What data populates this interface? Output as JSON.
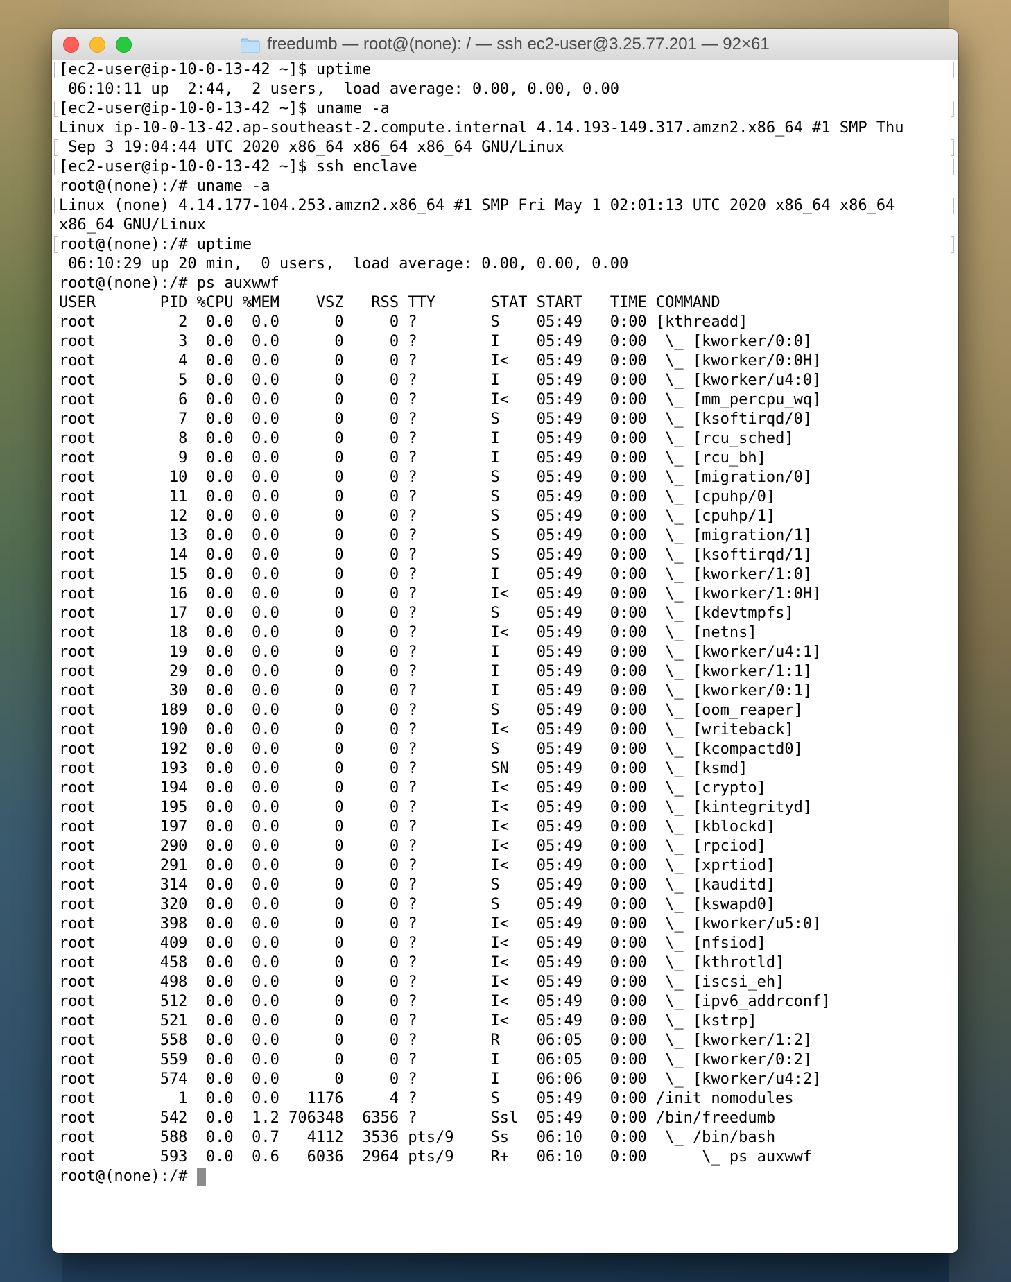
{
  "window": {
    "title": "freedumb — root@(none): / — ssh ec2-user@3.25.77.201 — 92×61"
  },
  "terminal": {
    "lines": [
      {
        "text": "[ec2-user@ip-10-0-13-42 ~]$ uptime",
        "mark": true
      },
      {
        "text": " 06:10:11 up  2:44,  2 users,  load average: 0.00, 0.00, 0.00",
        "mark": false
      },
      {
        "text": "[ec2-user@ip-10-0-13-42 ~]$ uname -a",
        "mark": true
      },
      {
        "text": "Linux ip-10-0-13-42.ap-southeast-2.compute.internal 4.14.193-149.317.amzn2.x86_64 #1 SMP Thu",
        "mark": false
      },
      {
        "text": " Sep 3 19:04:44 UTC 2020 x86_64 x86_64 x86_64 GNU/Linux",
        "mark": true
      },
      {
        "text": "[ec2-user@ip-10-0-13-42 ~]$ ssh enclave",
        "mark": true
      },
      {
        "text": "root@(none):/# uname -a",
        "mark": false
      },
      {
        "text": "Linux (none) 4.14.177-104.253.amzn2.x86_64 #1 SMP Fri May 1 02:01:13 UTC 2020 x86_64 x86_64",
        "mark": true
      },
      {
        "text": "x86_64 GNU/Linux",
        "mark": false
      },
      {
        "text": "root@(none):/# uptime",
        "mark": true
      },
      {
        "text": " 06:10:29 up 20 min,  0 users,  load average: 0.00, 0.00, 0.00",
        "mark": false
      },
      {
        "text": "root@(none):/# ps auxwwf",
        "mark": false
      },
      {
        "text": "USER       PID %CPU %MEM    VSZ   RSS TTY      STAT START   TIME COMMAND",
        "mark": false
      },
      {
        "text": "root         2  0.0  0.0      0     0 ?        S    05:49   0:00 [kthreadd]",
        "mark": false
      },
      {
        "text": "root         3  0.0  0.0      0     0 ?        I    05:49   0:00  \\_ [kworker/0:0]",
        "mark": false
      },
      {
        "text": "root         4  0.0  0.0      0     0 ?        I<   05:49   0:00  \\_ [kworker/0:0H]",
        "mark": false
      },
      {
        "text": "root         5  0.0  0.0      0     0 ?        I    05:49   0:00  \\_ [kworker/u4:0]",
        "mark": false
      },
      {
        "text": "root         6  0.0  0.0      0     0 ?        I<   05:49   0:00  \\_ [mm_percpu_wq]",
        "mark": false
      },
      {
        "text": "root         7  0.0  0.0      0     0 ?        S    05:49   0:00  \\_ [ksoftirqd/0]",
        "mark": false
      },
      {
        "text": "root         8  0.0  0.0      0     0 ?        I    05:49   0:00  \\_ [rcu_sched]",
        "mark": false
      },
      {
        "text": "root         9  0.0  0.0      0     0 ?        I    05:49   0:00  \\_ [rcu_bh]",
        "mark": false
      },
      {
        "text": "root        10  0.0  0.0      0     0 ?        S    05:49   0:00  \\_ [migration/0]",
        "mark": false
      },
      {
        "text": "root        11  0.0  0.0      0     0 ?        S    05:49   0:00  \\_ [cpuhp/0]",
        "mark": false
      },
      {
        "text": "root        12  0.0  0.0      0     0 ?        S    05:49   0:00  \\_ [cpuhp/1]",
        "mark": false
      },
      {
        "text": "root        13  0.0  0.0      0     0 ?        S    05:49   0:00  \\_ [migration/1]",
        "mark": false
      },
      {
        "text": "root        14  0.0  0.0      0     0 ?        S    05:49   0:00  \\_ [ksoftirqd/1]",
        "mark": false
      },
      {
        "text": "root        15  0.0  0.0      0     0 ?        I    05:49   0:00  \\_ [kworker/1:0]",
        "mark": false
      },
      {
        "text": "root        16  0.0  0.0      0     0 ?        I<   05:49   0:00  \\_ [kworker/1:0H]",
        "mark": false
      },
      {
        "text": "root        17  0.0  0.0      0     0 ?        S    05:49   0:00  \\_ [kdevtmpfs]",
        "mark": false
      },
      {
        "text": "root        18  0.0  0.0      0     0 ?        I<   05:49   0:00  \\_ [netns]",
        "mark": false
      },
      {
        "text": "root        19  0.0  0.0      0     0 ?        I    05:49   0:00  \\_ [kworker/u4:1]",
        "mark": false
      },
      {
        "text": "root        29  0.0  0.0      0     0 ?        I    05:49   0:00  \\_ [kworker/1:1]",
        "mark": false
      },
      {
        "text": "root        30  0.0  0.0      0     0 ?        I    05:49   0:00  \\_ [kworker/0:1]",
        "mark": false
      },
      {
        "text": "root       189  0.0  0.0      0     0 ?        S    05:49   0:00  \\_ [oom_reaper]",
        "mark": false
      },
      {
        "text": "root       190  0.0  0.0      0     0 ?        I<   05:49   0:00  \\_ [writeback]",
        "mark": false
      },
      {
        "text": "root       192  0.0  0.0      0     0 ?        S    05:49   0:00  \\_ [kcompactd0]",
        "mark": false
      },
      {
        "text": "root       193  0.0  0.0      0     0 ?        SN   05:49   0:00  \\_ [ksmd]",
        "mark": false
      },
      {
        "text": "root       194  0.0  0.0      0     0 ?        I<   05:49   0:00  \\_ [crypto]",
        "mark": false
      },
      {
        "text": "root       195  0.0  0.0      0     0 ?        I<   05:49   0:00  \\_ [kintegrityd]",
        "mark": false
      },
      {
        "text": "root       197  0.0  0.0      0     0 ?        I<   05:49   0:00  \\_ [kblockd]",
        "mark": false
      },
      {
        "text": "root       290  0.0  0.0      0     0 ?        I<   05:49   0:00  \\_ [rpciod]",
        "mark": false
      },
      {
        "text": "root       291  0.0  0.0      0     0 ?        I<   05:49   0:00  \\_ [xprtiod]",
        "mark": false
      },
      {
        "text": "root       314  0.0  0.0      0     0 ?        S    05:49   0:00  \\_ [kauditd]",
        "mark": false
      },
      {
        "text": "root       320  0.0  0.0      0     0 ?        S    05:49   0:00  \\_ [kswapd0]",
        "mark": false
      },
      {
        "text": "root       398  0.0  0.0      0     0 ?        I<   05:49   0:00  \\_ [kworker/u5:0]",
        "mark": false
      },
      {
        "text": "root       409  0.0  0.0      0     0 ?        I<   05:49   0:00  \\_ [nfsiod]",
        "mark": false
      },
      {
        "text": "root       458  0.0  0.0      0     0 ?        I<   05:49   0:00  \\_ [kthrotld]",
        "mark": false
      },
      {
        "text": "root       498  0.0  0.0      0     0 ?        I<   05:49   0:00  \\_ [iscsi_eh]",
        "mark": false
      },
      {
        "text": "root       512  0.0  0.0      0     0 ?        I<   05:49   0:00  \\_ [ipv6_addrconf]",
        "mark": false
      },
      {
        "text": "root       521  0.0  0.0      0     0 ?        I<   05:49   0:00  \\_ [kstrp]",
        "mark": false
      },
      {
        "text": "root       558  0.0  0.0      0     0 ?        R    06:05   0:00  \\_ [kworker/1:2]",
        "mark": false
      },
      {
        "text": "root       559  0.0  0.0      0     0 ?        I    06:05   0:00  \\_ [kworker/0:2]",
        "mark": false
      },
      {
        "text": "root       574  0.0  0.0      0     0 ?        I    06:06   0:00  \\_ [kworker/u4:2]",
        "mark": false
      },
      {
        "text": "root         1  0.0  0.0   1176     4 ?        S    05:49   0:00 /init nomodules",
        "mark": false
      },
      {
        "text": "root       542  0.0  1.2 706348  6356 ?        Ssl  05:49   0:00 /bin/freedumb",
        "mark": false
      },
      {
        "text": "root       588  0.0  0.7   4112  3536 pts/9    Ss   06:10   0:00  \\_ /bin/bash",
        "mark": false
      },
      {
        "text": "root       593  0.0  0.6   6036  2964 pts/9    R+   06:10   0:00      \\_ ps auxwwf",
        "mark": false
      }
    ],
    "prompt": "root@(none):/# "
  }
}
